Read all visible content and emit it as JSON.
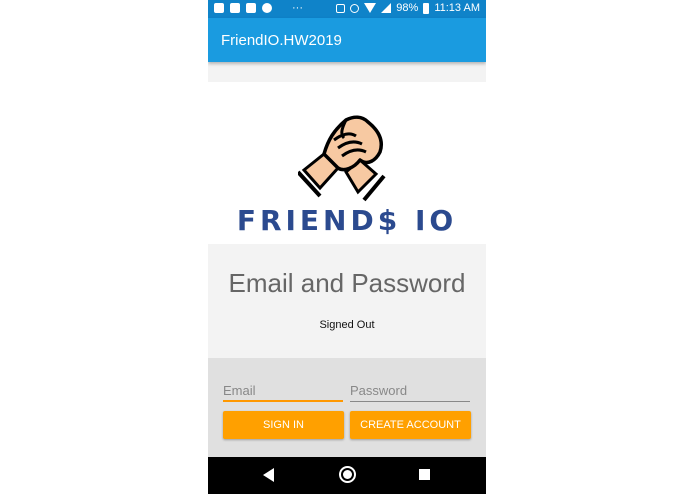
{
  "status_bar": {
    "battery": "98%",
    "time": "11:13 AM",
    "dots": "···"
  },
  "app_bar": {
    "title": "FriendIO.HW2019"
  },
  "logo": {
    "text": "FRIEND$ IO"
  },
  "main": {
    "heading": "Email and Password",
    "status": "Signed Out"
  },
  "form": {
    "email_placeholder": "Email",
    "password_placeholder": "Password",
    "sign_in_label": "SIGN IN",
    "create_account_label": "CREATE ACCOUNT"
  },
  "colors": {
    "app_bar": "#1a9be0",
    "status_bar": "#0f83c9",
    "accent": "#ffa000"
  }
}
